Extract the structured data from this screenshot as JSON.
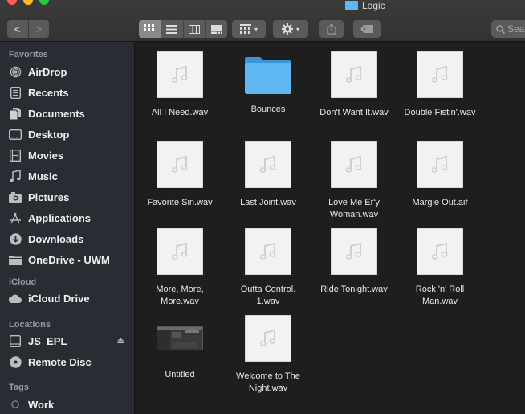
{
  "window": {
    "title": "Logic"
  },
  "toolbar": {
    "back_label": "<",
    "forward_label": ">",
    "search_placeholder": "Sea"
  },
  "sidebar": {
    "favorites_label": "Favorites",
    "favorites": [
      {
        "label": "AirDrop",
        "icon": "airdrop-icon"
      },
      {
        "label": "Recents",
        "icon": "recents-icon"
      },
      {
        "label": "Documents",
        "icon": "documents-icon"
      },
      {
        "label": "Desktop",
        "icon": "desktop-icon"
      },
      {
        "label": "Movies",
        "icon": "movies-icon"
      },
      {
        "label": "Music",
        "icon": "music-icon"
      },
      {
        "label": "Pictures",
        "icon": "pictures-icon"
      },
      {
        "label": "Applications",
        "icon": "applications-icon"
      },
      {
        "label": "Downloads",
        "icon": "downloads-icon"
      },
      {
        "label": "OneDrive - UWM",
        "icon": "folder-icon"
      }
    ],
    "icloud_label": "iCloud",
    "icloud": [
      {
        "label": "iCloud Drive",
        "icon": "cloud-icon"
      }
    ],
    "locations_label": "Locations",
    "locations": [
      {
        "label": "JS_EPL",
        "icon": "drive-icon"
      },
      {
        "label": "Remote Disc",
        "icon": "disc-icon"
      }
    ],
    "tags_label": "Tags",
    "tags": [
      {
        "label": "Work",
        "icon": "tag-dot-icon"
      }
    ]
  },
  "files": [
    {
      "name": "All I Need.wav",
      "kind": "audio"
    },
    {
      "name": "Bounces",
      "kind": "folder"
    },
    {
      "name": "Don't Want It.wav",
      "kind": "audio"
    },
    {
      "name": "Double Fistin'.wav",
      "kind": "audio"
    },
    {
      "name": "Favorite Sin.wav",
      "kind": "audio"
    },
    {
      "name": "Last Joint.wav",
      "kind": "audio"
    },
    {
      "name": "Love Me Er'y\nWoman.wav",
      "kind": "audio"
    },
    {
      "name": "Margie Out.aif",
      "kind": "audio"
    },
    {
      "name": "More, More,\nMore.wav",
      "kind": "audio"
    },
    {
      "name": "Outta Control.\n1.wav",
      "kind": "audio"
    },
    {
      "name": "Ride Tonight.wav",
      "kind": "audio"
    },
    {
      "name": "Rock 'n' Roll\nMan.wav",
      "kind": "audio"
    },
    {
      "name": "Untitled",
      "kind": "screenshot"
    },
    {
      "name": "Welcome to The\nNight.wav",
      "kind": "audio"
    }
  ],
  "colors": {
    "folder_blue": "#5eb7f0",
    "sidebar_bg": "#2a2c33",
    "content_bg": "#1e1e1e"
  }
}
